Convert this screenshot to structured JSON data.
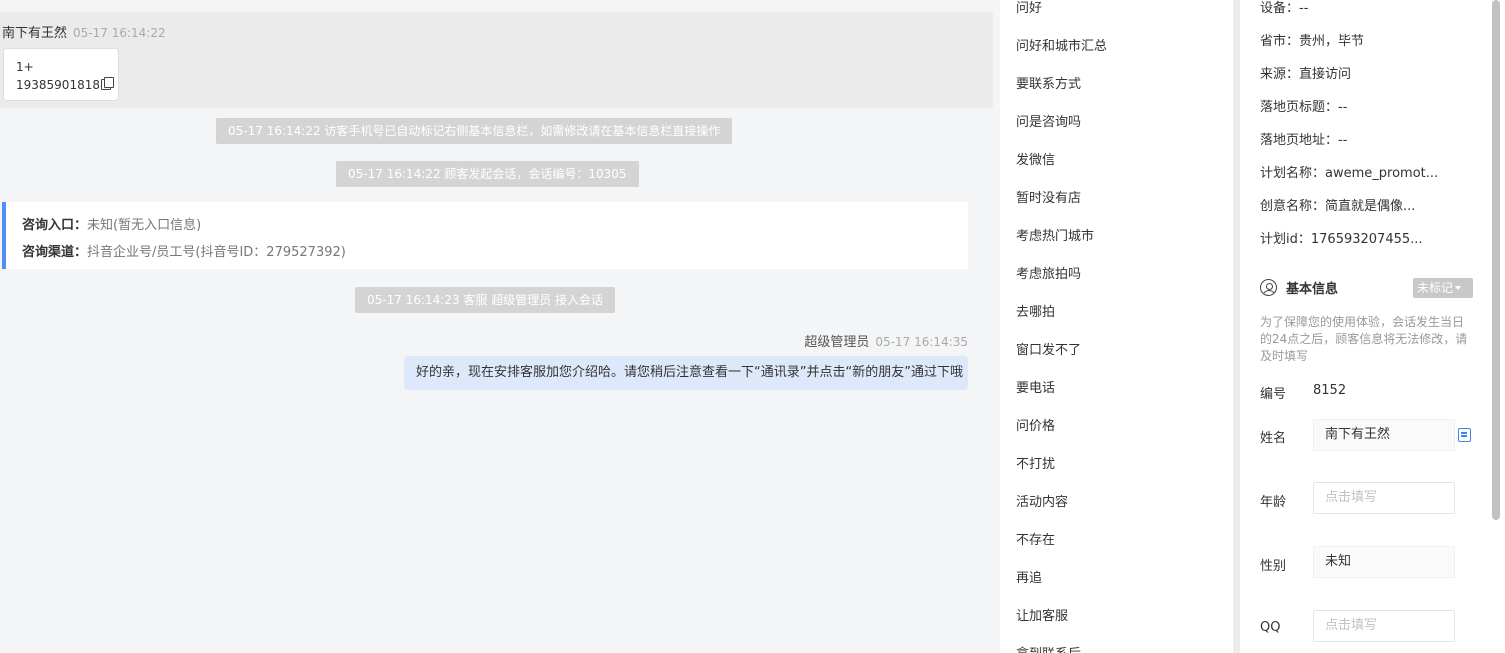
{
  "chat": {
    "visitor": {
      "name": "南下有王然",
      "time": "05-17 16:14:22",
      "phone_prefix": "1+",
      "phone_number": "19385901818"
    },
    "system_messages": [
      "05-17 16:14:22 访客手机号已自动标记右侧基本信息栏，如需修改请在基本信息栏直接操作",
      "05-17 16:14:22 顾客发起会话，会话编号：10305",
      "05-17 16:14:23 客服 超级管理员 接入会话"
    ],
    "entry": {
      "entry_label": "咨询入口：",
      "entry_value": "未知(暂无入口信息)",
      "channel_label": "咨询渠道：",
      "channel_value": "抖音企业号/员工号(抖音号ID：279527392)"
    },
    "agent": {
      "name": "超级管理员",
      "time": "05-17 16:14:35",
      "message": "好的亲，现在安排客服加您介绍哈。请您稍后注意查看一下“通讯录”并点击“新的朋友”通过下哦"
    }
  },
  "quick_replies": [
    "问好",
    "问好和城市汇总",
    "要联系方式",
    "问是咨询吗",
    "发微信",
    "暂时没有店",
    "考虑热门城市",
    "考虑旅拍吗",
    "去哪拍",
    "窗口发不了",
    "要电话",
    "问价格",
    "不打扰",
    "活动内容",
    "不存在",
    "再追",
    "让加客服",
    "拿到联系后"
  ],
  "info": {
    "source_fields": [
      {
        "label": "设备：",
        "value": "--"
      },
      {
        "label": "省市：",
        "value": "贵州，毕节"
      },
      {
        "label": "来源：",
        "value": "直接访问"
      },
      {
        "label": "落地页标题：",
        "value": "--"
      },
      {
        "label": "落地页地址：",
        "value": "--"
      },
      {
        "label": "计划名称：",
        "value": "aweme_promot..."
      },
      {
        "label": "创意名称：",
        "value": "简直就是偶像..."
      },
      {
        "label": "计划id：",
        "value": "176593207455..."
      }
    ],
    "basic_title": "基本信息",
    "tag_dropdown": "未标记",
    "notice": "为了保障您的使用体验，会话发生当日的24点之后，顾客信息将无法修改，请及时填写",
    "id_label": "编号",
    "id_value": "8152",
    "name_label": "姓名",
    "name_value": "南下有王然",
    "age_label": "年龄",
    "age_placeholder": "点击填写",
    "gender_label": "性别",
    "gender_value": "未知",
    "qq_label": "QQ",
    "qq_placeholder": "点击填写"
  },
  "colors": {
    "accent": "#4f8ff7",
    "agent_bubble": "#dde9fb",
    "system_pill": "#d4d4d4"
  }
}
